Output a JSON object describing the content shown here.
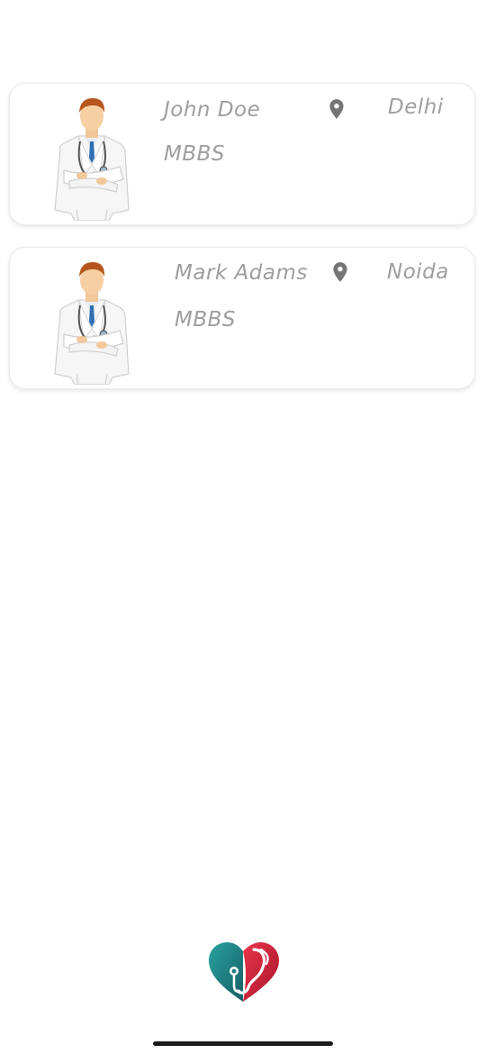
{
  "doctors": [
    {
      "name": "John Doe",
      "degree": "MBBS",
      "city": "Delhi"
    },
    {
      "name": "Mark Adams",
      "degree": "MBBS",
      "city": "Noida"
    }
  ],
  "icons": {
    "location": "map-pin-icon",
    "avatar": "doctor-avatar-icon",
    "logo": "heart-stethoscope-logo"
  },
  "colors": {
    "text": "#9e9e9e",
    "pin": "#757575",
    "logo_teal": "#1f8a8c",
    "logo_red": "#d52a3c"
  }
}
